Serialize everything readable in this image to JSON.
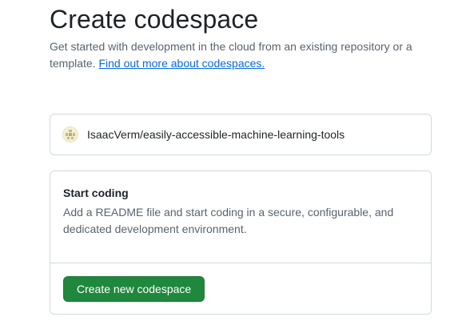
{
  "header": {
    "title": "Create codespace",
    "subtitle": "Get started with development in the cloud from an existing repository or a template.",
    "learn_more_link": "Find out more about codespaces."
  },
  "repository": {
    "name": "IsaacVerm/easily-accessible-machine-learning-tools",
    "avatar_icon": "identicon-avatar"
  },
  "start_coding": {
    "heading": "Start coding",
    "description": "Add a README file and start coding in a secure, configurable, and dedicated development environment.",
    "button_label": "Create new codespace"
  },
  "colors": {
    "primary_button": "#1f883d",
    "link": "#0969da",
    "muted_text": "#59636e",
    "border": "#d1d9e0"
  }
}
